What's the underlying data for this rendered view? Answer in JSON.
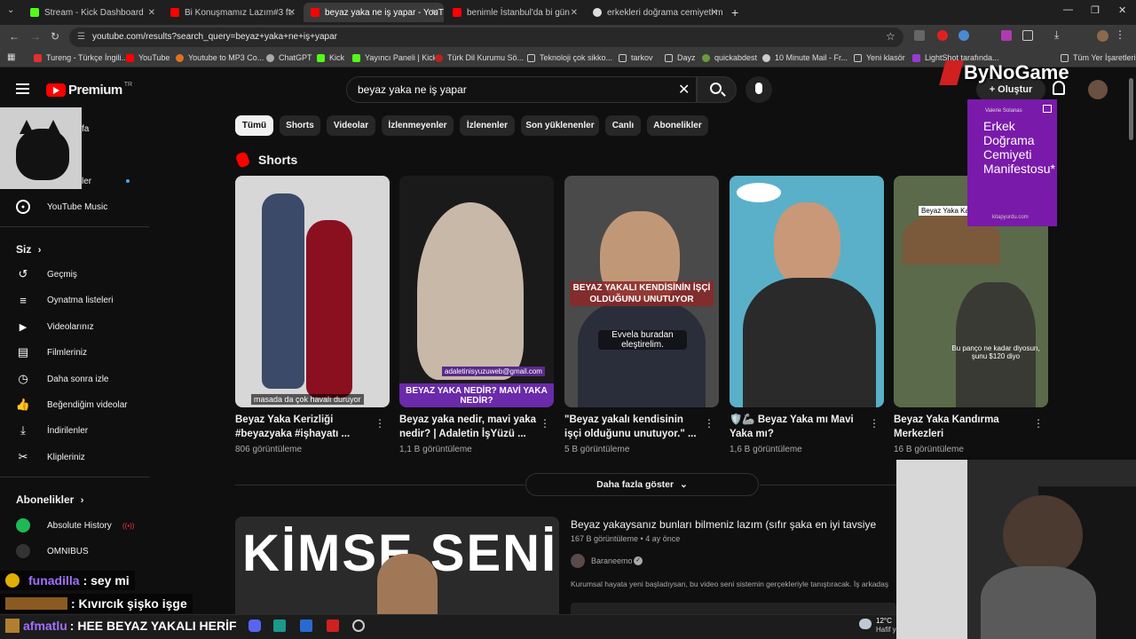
{
  "browser": {
    "tabs": [
      {
        "title": "Stream - Kick Dashboard",
        "color": "#53fc18"
      },
      {
        "title": "Bi Konuşmamız Lazım#3 ft.",
        "color": "#ff0000"
      },
      {
        "title": "beyaz yaka ne iş yapar - YouTu",
        "color": "#ff0000"
      },
      {
        "title": "benimle İstanbul'da bi gün",
        "color": "#ff0000"
      },
      {
        "title": "erkekleri doğrama cemiyeti ma",
        "color": "#dddddd"
      }
    ],
    "url": "youtube.com/results?search_query=beyaz+yaka+ne+iş+yapar",
    "bookmarks": [
      "Tureng - Türkçe İngili...",
      "YouTube",
      "Youtube to MP3 Co...",
      "ChatGPT",
      "Kick",
      "Yayıncı Paneli | Kick",
      "Türk Dil Kurumu Sö...",
      "Teknoloji çok sikko...",
      "tarkov",
      "Dayz",
      "quickabdest",
      "10 Minute Mail - Fr...",
      "Yeni klasör",
      "LightShot tarafında...",
      "Tüm Yer İşaretleri"
    ]
  },
  "youtube": {
    "logo_text": "Premium",
    "logo_region": "TR",
    "search_value": "beyaz yaka ne iş yapar",
    "create_label": "Oluştur",
    "chips": [
      "Tümü",
      "Shorts",
      "Videolar",
      "İzlenmeyenler",
      "İzlenenler",
      "Son yüklenenler",
      "Canlı",
      "Abonelikler"
    ]
  },
  "sidebar": {
    "partial_top": [
      "fa",
      "ler"
    ],
    "music": "YouTube Music",
    "you_header": "Siz",
    "you_items": [
      {
        "label": "Geçmiş",
        "icon": "history-icon"
      },
      {
        "label": "Oynatma listeleri",
        "icon": "playlist-icon"
      },
      {
        "label": "Videolarınız",
        "icon": "video-icon"
      },
      {
        "label": "Filmleriniz",
        "icon": "film-icon"
      },
      {
        "label": "Daha sonra izle",
        "icon": "clock-icon"
      },
      {
        "label": "Beğendiğim videolar",
        "icon": "like-icon"
      },
      {
        "label": "İndirilenler",
        "icon": "download-icon"
      },
      {
        "label": "Klipleriniz",
        "icon": "scissors-icon"
      }
    ],
    "subs_header": "Abonelikler",
    "subs": [
      "Absolute History",
      "OMNIBUS"
    ]
  },
  "shorts": {
    "header": "Shorts",
    "items": [
      {
        "title": "Beyaz Yaka Kerizliği #beyazyaka #işhayatı ...",
        "views": "806 görüntüleme",
        "overlay": "masada da çok havalı duruyor"
      },
      {
        "title": "Beyaz yaka nedir, mavi yaka nedir? | Adaletin İşYüzü ...",
        "views": "1,1 B görüntüleme",
        "overlay": "BEYAZ YAKA NEDİR? MAVİ YAKA NEDİR?",
        "email": "adaletinisyuzuweb@gmail.com"
      },
      {
        "title": "\"Beyaz yakalı kendisinin işçi olduğunu unutuyor.\" ...",
        "views": "5 B görüntüleme",
        "overlay": "BEYAZ YAKALI KENDİSİNİN İŞÇİ OLDUĞUNU UNUTUYOR",
        "caption": "Evvela buradan eleştirelim."
      },
      {
        "title": "🛡️🦾 Beyaz Yaka mı Mavi Yaka mı?",
        "views": "1,6 B görüntüleme"
      },
      {
        "title": "Beyaz Yaka Kandırma Merkezleri",
        "views": "16 B görüntüleme",
        "overlay": "Beyaz Yaka Ka",
        "caption": "Bu panço ne kadar diyosun, şunu $120 diyo"
      }
    ],
    "more_label": "Daha fazla göster"
  },
  "video": {
    "title": "Beyaz yakaysanız bunları bilmeniz lazım (sıfır şaka en iyi tavsiye",
    "meta": "167 B görüntüleme • 4 ay önce",
    "channel": "Baraneemo",
    "description": "Kurumsal hayata yeni başladıysan, bu video seni sistemin gerçekleriyle tanıştıracak. İş arkadaş",
    "thumb_text": "KİMSE SENİ"
  },
  "overlays": {
    "watermark": "ByNoGame",
    "book": {
      "author": "Valerie Solanas",
      "title": "Erkek Doğrama Cemiyeti Manifestosu*",
      "site": "kitapyurdu.com"
    },
    "chat": [
      {
        "user": "funadilla",
        "msg": ": sey mi"
      },
      {
        "user": "",
        "msg": ": Kıvırcık şişko işge"
      },
      {
        "user": "afmatlu",
        "msg": ": HEE BEYAZ YAKALI HERİF"
      }
    ],
    "weather": {
      "temp": "12°C",
      "text": "Hafif y"
    }
  }
}
